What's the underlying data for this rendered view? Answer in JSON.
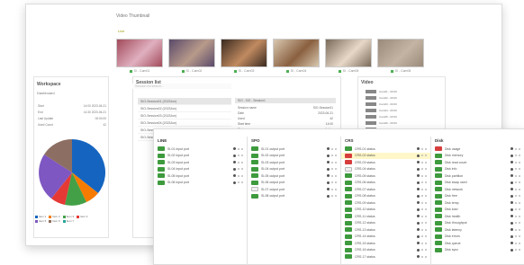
{
  "thumbnails": {
    "title": "Video Thumbnail",
    "tag": "Live",
    "captions": [
      "SI - Cam01",
      "SI - Cam02",
      "SI - Cam03",
      "SI - Cam04",
      "SI - Cam05",
      "SI - Cam06"
    ]
  },
  "dashboard": {
    "title": "Workspace",
    "subtitle": "Dashboard",
    "stats": [
      [
        "Start",
        "14:00 2023-06-21"
      ],
      [
        "End",
        "14:30 2023-06-21"
      ],
      [
        "Last Update",
        "00:00:00"
      ],
      [
        "Used Count",
        "42"
      ]
    ],
    "legend": [
      "Item 1",
      "Item 2",
      "Item 3",
      "Item 4",
      "Item 5",
      "Item 6",
      "Item 7"
    ],
    "legend_colors": [
      "#1565c0",
      "#f57c00",
      "#43a047",
      "#e53935",
      "#7e57c2",
      "#8d6e63",
      "#26a69a"
    ]
  },
  "session": {
    "title": "Session list",
    "header": "Session list search...",
    "items": [
      "SIO-Session01 (2023Jun)",
      "SIO-Session02 (2023Jun)",
      "SIO-Session03 (2023Jun)",
      "SIO-Session04 (2023Jun)",
      "SIO-Session05 (2023Jun)",
      "SIO-Session06 (2023Jun)"
    ],
    "detail_header": "SIO - SIO - Session1",
    "detail_rows": [
      [
        "Session name",
        "SIO-Session01"
      ],
      [
        "Date",
        "2023-06-21"
      ],
      [
        "Used",
        "42"
      ],
      [
        "Start time",
        "14:00"
      ],
      [
        "Status",
        "Active"
      ]
    ]
  },
  "video": {
    "title": "Video",
    "items": [
      "Cam01 - 00:00",
      "Cam02 - 00:00",
      "Cam03 - 00:00",
      "Cam04 - 00:00",
      "Cam05 - 00:00",
      "Cam06 - 00:00",
      "Cam07 - 00:00"
    ]
  },
  "columns": [
    {
      "title": "LINE",
      "rows": [
        {
          "badge": "g",
          "label": "SI-01 input port"
        },
        {
          "badge": "g",
          "label": "SI-02 input port"
        },
        {
          "badge": "g",
          "label": "SI-03 input port"
        },
        {
          "badge": "g",
          "label": "SI-04 input port"
        },
        {
          "badge": "g",
          "label": "SI-05 input port"
        },
        {
          "badge": "g",
          "label": "SI-06 input port"
        }
      ]
    },
    {
      "title": "SPO",
      "rows": [
        {
          "badge": "g",
          "label": "SI-01 output port"
        },
        {
          "badge": "g",
          "label": "SI-02 output port"
        },
        {
          "badge": "g",
          "label": "SI-03 output port"
        },
        {
          "badge": "g",
          "label": "SI-04 output port"
        },
        {
          "badge": "g",
          "label": "SI-05 output port"
        },
        {
          "badge": "g",
          "label": "SI-06 output port"
        },
        {
          "badge": "o",
          "label": "SI-07 output port"
        },
        {
          "badge": "g",
          "label": "SI-08 output port"
        }
      ]
    },
    {
      "title": "CRS",
      "rows": [
        {
          "badge": "g",
          "label": "CRS-01 status"
        },
        {
          "badge": "r",
          "label": "CRS-02 status",
          "selected": true
        },
        {
          "badge": "r",
          "label": "CRS-03 status"
        },
        {
          "badge": "o",
          "label": "CRS-04 status"
        },
        {
          "badge": "g",
          "label": "CRS-05 status"
        },
        {
          "badge": "g",
          "label": "CRS-06 status"
        },
        {
          "badge": "g",
          "label": "CRS-07 status"
        },
        {
          "badge": "g",
          "label": "CRS-08 status"
        },
        {
          "badge": "g",
          "label": "CRS-09 status"
        },
        {
          "badge": "g",
          "label": "CRS-10 status"
        },
        {
          "badge": "g",
          "label": "CRS-11 status"
        },
        {
          "badge": "g",
          "label": "CRS-12 status"
        },
        {
          "badge": "g",
          "label": "CRS-13 status"
        },
        {
          "badge": "g",
          "label": "CRS-14 status"
        },
        {
          "badge": "g",
          "label": "CRS-15 status"
        },
        {
          "badge": "g",
          "label": "CRS-16 status"
        },
        {
          "badge": "g",
          "label": "CRS-17 status"
        }
      ]
    },
    {
      "title": "Disk",
      "rows": [
        {
          "badge": "r",
          "label": "Disk usage"
        },
        {
          "badge": "g",
          "label": "Disk memory"
        },
        {
          "badge": "g",
          "label": "Disk read count"
        },
        {
          "badge": "g",
          "label": "Disk info"
        },
        {
          "badge": "g",
          "label": "Disk partition"
        },
        {
          "badge": "g",
          "label": "Disk swap used"
        },
        {
          "badge": "g",
          "label": "Disk network"
        },
        {
          "badge": "g",
          "label": "Disk free"
        },
        {
          "badge": "g",
          "label": "Disk temp"
        },
        {
          "badge": "g",
          "label": "Disk load"
        },
        {
          "badge": "g",
          "label": "Disk health"
        },
        {
          "badge": "g",
          "label": "Disk throughput"
        },
        {
          "badge": "g",
          "label": "Disk latency"
        },
        {
          "badge": "g",
          "label": "Disk errors"
        },
        {
          "badge": "g",
          "label": "Disk queue"
        },
        {
          "badge": "g",
          "label": "Disk sync"
        }
      ]
    }
  ]
}
